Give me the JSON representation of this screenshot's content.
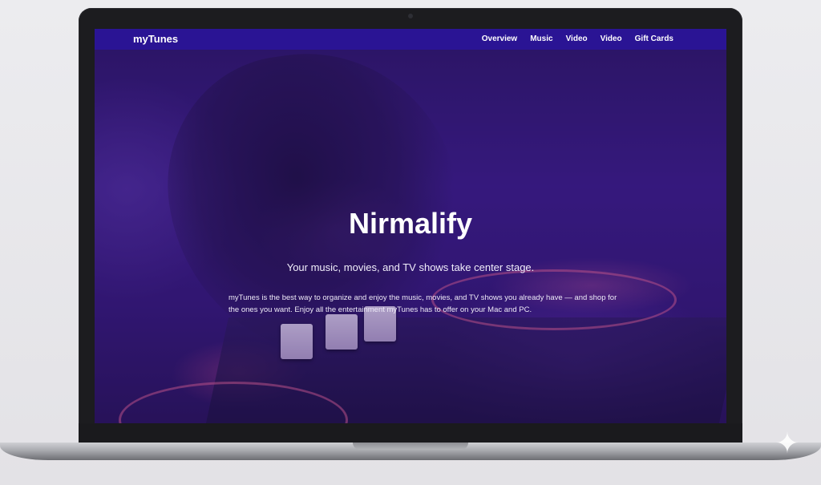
{
  "nav": {
    "brand": "myTunes",
    "links": [
      "Overview",
      "Music",
      "Video",
      "Video",
      "Gift Cards"
    ]
  },
  "hero": {
    "title": "Nirmalify",
    "subtitle": "Your music, movies, and TV shows take center stage.",
    "body": "myTunes is the best way to organize and enjoy the music, movies, and TV shows you already have — and shop for the ones you want. Enjoy all the entertainment myTunes has to offer on your Mac and PC."
  },
  "colors": {
    "nav_bg": "#2a1494",
    "hero_tint": "#3a1a86",
    "text": "#ffffff"
  },
  "icons": {
    "watermark": "sparkle-icon"
  }
}
